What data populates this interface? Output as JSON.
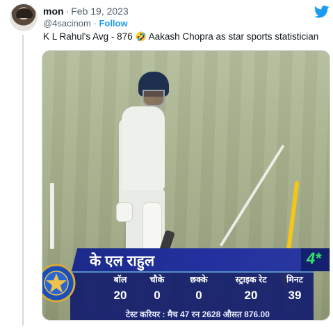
{
  "tweet": {
    "author_name": "mon",
    "separator": "·",
    "date": "Feb 19, 2023",
    "handle": "@4sacinom",
    "handle_separator": "·",
    "follow_label": "Follow",
    "text_before_emoji": "K L Rahul's Avg - 876",
    "emoji": "🤣",
    "text_after_emoji": "Aakash Chopra as star sports statistician"
  },
  "icons": {
    "platform_icon": "twitter-bird-icon",
    "platform_color": "#1d9bf0",
    "crest_icon": "bcci-crest-icon",
    "arrow_icon": "yellow-arrow-icon",
    "arrow_color": "#f5c518"
  },
  "scorecard": {
    "player_name": "के एल राहुल",
    "badge": "4*",
    "badge_color": "#32e36a",
    "stats": [
      {
        "label": "बॉल",
        "value": "20"
      },
      {
        "label": "चौके",
        "value": "0"
      },
      {
        "label": "छक्के",
        "value": "0"
      },
      {
        "label": "स्ट्राइक रेट",
        "value": "20"
      },
      {
        "label": "मिनट",
        "value": "39"
      }
    ],
    "career_line": "टेस्ट करियर : मैच 47  रन 2628  औसत 876.00"
  }
}
